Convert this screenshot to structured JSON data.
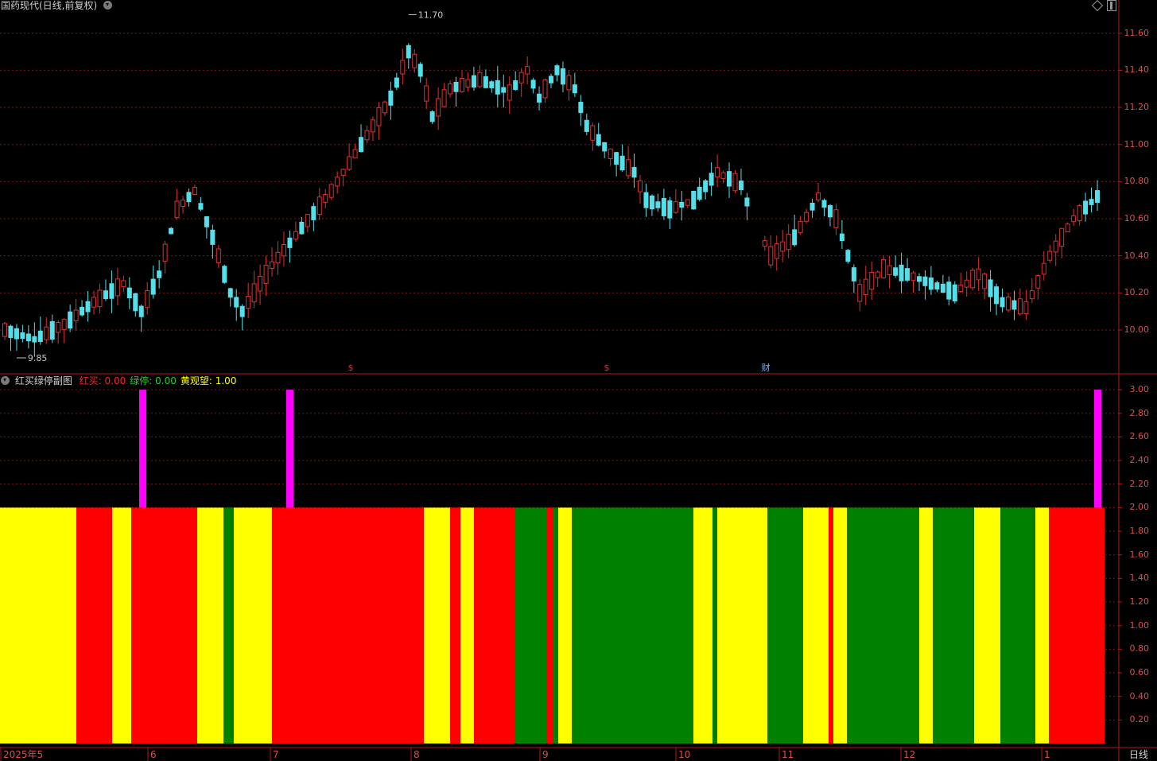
{
  "header": {
    "title": "国药现代(日线,前复权)",
    "icons": [
      "chevron-down-icon",
      "diamond-icon",
      "panel-toggle-icon"
    ]
  },
  "price_chart": {
    "y_ticks": [
      "11.60",
      "11.40",
      "11.20",
      "11.00",
      "10.80",
      "10.60",
      "10.40",
      "10.20",
      "10.00"
    ],
    "high_label": "11.70",
    "low_label": "9.85",
    "markers": [
      "$",
      "$",
      "财"
    ],
    "colors": {
      "up": "#e03030",
      "down": "#54e0ea",
      "grid": "#7a1818",
      "axis": "#b01818"
    }
  },
  "indicator": {
    "name": "红买绿停副图",
    "legend": [
      {
        "label": "红买",
        "value": "0.00",
        "color": "#ff2020"
      },
      {
        "label": "绿停",
        "value": "0.00",
        "color": "#20d020"
      },
      {
        "label": "黄观望",
        "value": "1.00",
        "color": "#ffff00"
      }
    ],
    "y_ticks": [
      "3.00",
      "2.80",
      "2.60",
      "2.40",
      "2.20",
      "2.00",
      "1.80",
      "1.60",
      "1.40",
      "1.20",
      "1.00",
      "0.80",
      "0.60",
      "0.40",
      "0.20"
    ],
    "colors": {
      "red": "#ff0000",
      "green": "#008000",
      "yellow": "#ffff00",
      "magenta": "#ff00ff"
    }
  },
  "x_axis": {
    "labels": [
      "2025年5",
      "6",
      "7",
      "8",
      "9",
      "10",
      "11",
      "12",
      "1"
    ],
    "period": "日线"
  }
}
